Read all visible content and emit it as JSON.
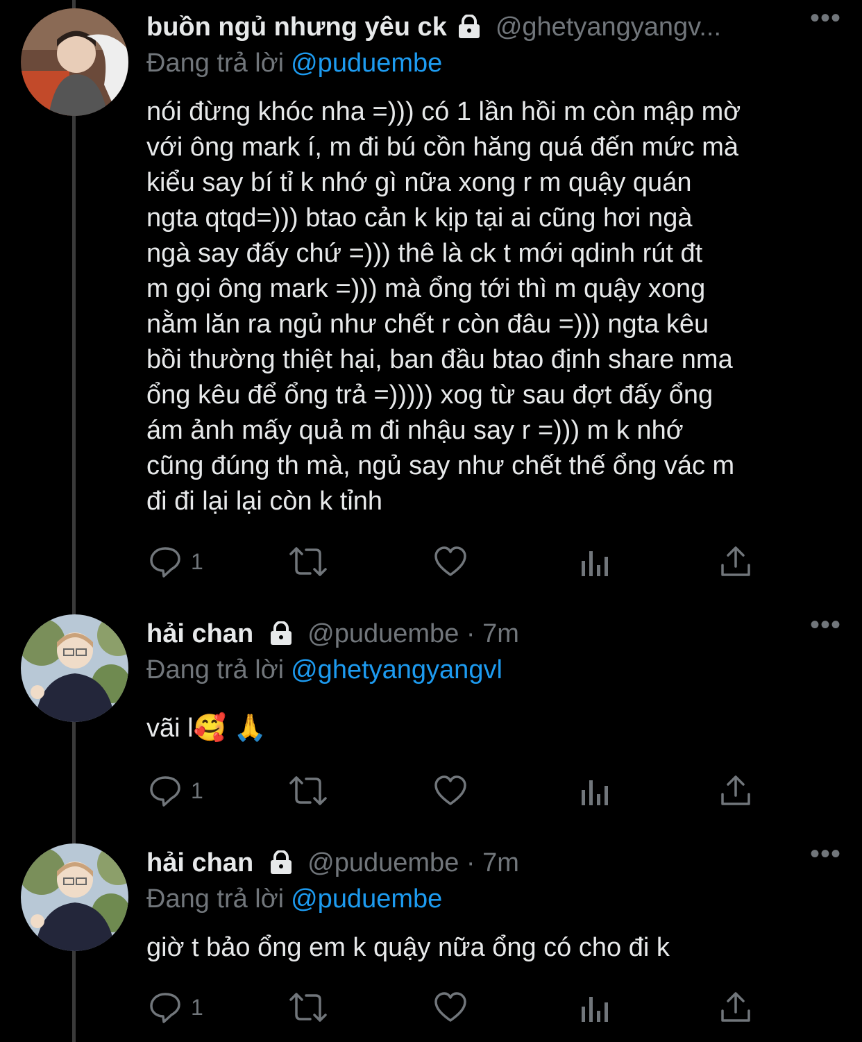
{
  "tweets": [
    {
      "display_name": "buồn ngủ nhưng yêu ck",
      "handle": "@ghetyangyangv...",
      "time": "",
      "replying_label": "Đang trả lời",
      "replying_to": "@puduembe",
      "text": "nói đừng khóc nha =))) có 1 lần hồi m còn mập mờ\nvới ông mark í, m đi bú cồn hăng quá đến mức mà\nkiểu say bí tỉ k nhớ gì nữa xong r m quậy quán\nngta qtqd=))) btao cản k kịp tại ai cũng hơi ngà\nngà say đấy chứ =))) thê là ck t mới qdinh rút đt\nm gọi ông mark =))) mà ổng tới thì m quậy xong\nnằm lăn ra ngủ như chết r còn đâu =))) ngta kêu\nbồi thường thiệt hại, ban đầu btao định share nma\nổng kêu để ổng trả =))))) xog từ sau đợt đấy ổng\nám ảnh mấy quả m đi nhậu say r =))) m k nhớ\ncũng đúng th mà, ngủ say như chết thế ổng vác m\nđi đi lại lại còn k tỉnh",
      "reply_count": "1",
      "more": "•••"
    },
    {
      "display_name": "hải chan",
      "handle": "@puduembe · 7m",
      "replying_label": "Đang trả lời",
      "replying_to": "@ghetyangyangvl",
      "text": "vãi l🥰 🙏",
      "reply_count": "1",
      "more": "•••"
    },
    {
      "display_name": "hải chan",
      "handle": "@puduembe · 7m",
      "replying_label": "Đang trả lời",
      "replying_to": "@puduembe",
      "text": "giờ t bảo ổng em k quậy nữa ổng có cho đi k",
      "reply_count": "1",
      "more": "•••"
    }
  ],
  "icons": [
    "reply-icon",
    "retweet-icon",
    "like-icon",
    "analytics-icon",
    "share-icon",
    "lock-icon"
  ],
  "colors": {
    "background": "#000000",
    "text": "#e7e9ea",
    "muted": "#71767b",
    "link": "#1d9bf0"
  }
}
